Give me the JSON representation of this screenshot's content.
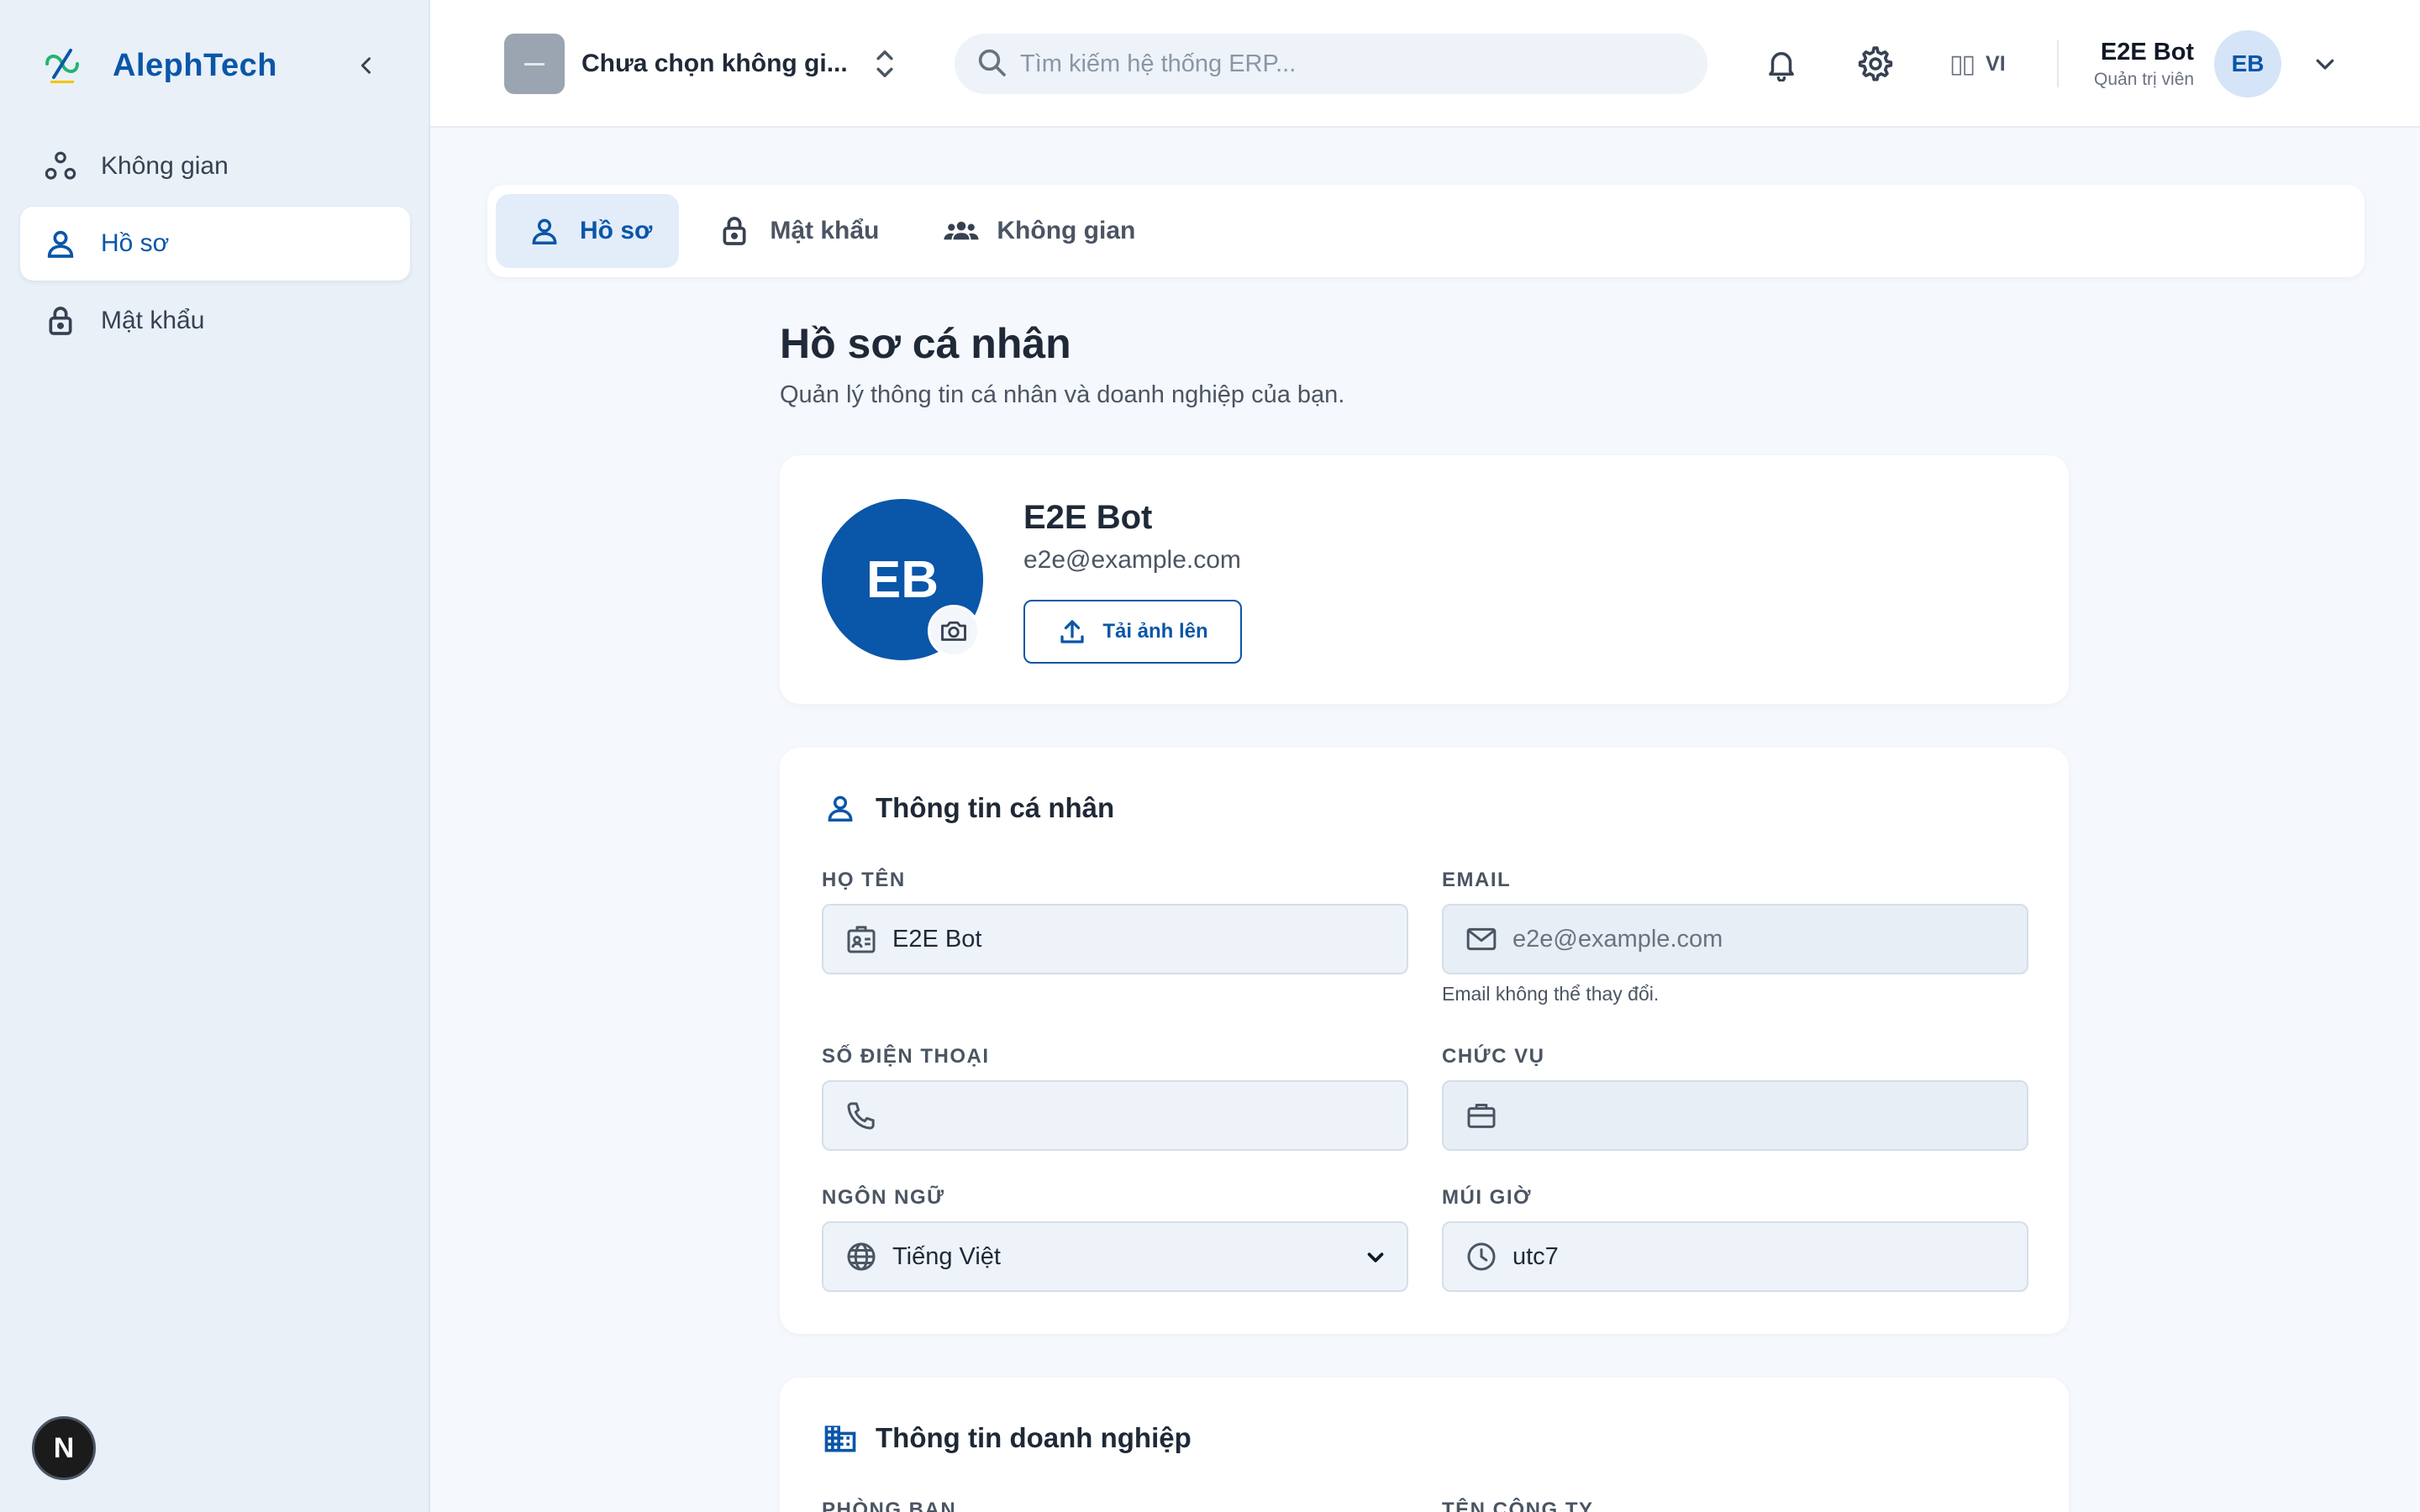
{
  "brand": {
    "name": "AlephTech"
  },
  "sidebar": {
    "items": [
      {
        "label": "Không gian",
        "icon": "spaces-icon",
        "active": false
      },
      {
        "label": "Hồ sơ",
        "icon": "user-icon",
        "active": true
      },
      {
        "label": "Mật khẩu",
        "icon": "lock-icon",
        "active": false
      }
    ],
    "badge": "N"
  },
  "header": {
    "workspace_label": "Chưa chọn không gi...",
    "search_placeholder": "Tìm kiếm hệ thống ERP...",
    "lang_flag": "▯▯",
    "lang": "VI",
    "user_name": "E2E Bot",
    "user_role": "Quản trị viên",
    "user_initials": "EB"
  },
  "tabs": [
    {
      "label": "Hồ sơ",
      "active": true
    },
    {
      "label": "Mật khẩu",
      "active": false
    },
    {
      "label": "Không gian",
      "active": false
    }
  ],
  "page": {
    "title": "Hồ sơ cá nhân",
    "subtitle": "Quản lý thông tin cá nhân và doanh nghiệp của bạn."
  },
  "profile": {
    "initials": "EB",
    "name": "E2E Bot",
    "email": "e2e@example.com",
    "upload_label": "Tải ảnh lên"
  },
  "personal": {
    "heading": "Thông tin cá nhân",
    "full_name_label": "HỌ TÊN",
    "full_name_value": "E2E Bot",
    "email_label": "EMAIL",
    "email_value": "e2e@example.com",
    "email_hint": "Email không thể thay đổi.",
    "phone_label": "SỐ ĐIỆN THOẠI",
    "phone_value": "",
    "position_label": "CHỨC VỤ",
    "position_value": "",
    "language_label": "NGÔN NGỮ",
    "language_value": "Tiếng Việt",
    "timezone_label": "MÚI GIỜ",
    "timezone_value": "utc7"
  },
  "business": {
    "heading": "Thông tin doanh nghiệp",
    "department_label": "PHÒNG BAN",
    "company_label": "TÊN CÔNG TY"
  },
  "colors": {
    "accent": "#0a56a8",
    "sidebar_bg": "#e9f0f8",
    "page_bg": "#f5f8fc",
    "field_bg": "#eef3f9"
  }
}
